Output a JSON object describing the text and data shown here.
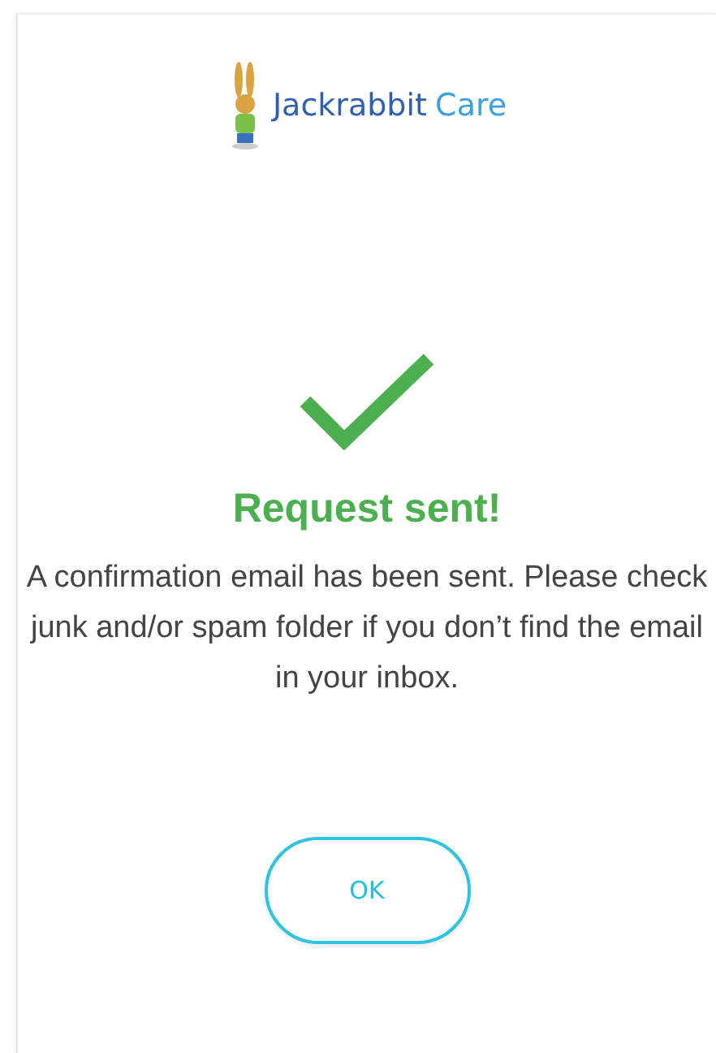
{
  "brand": {
    "name": "Jackrabbit",
    "suffix": "Care"
  },
  "status": {
    "title": "Request sent!",
    "message": "A confirmation email has been sent. Please check junk and/or spam folder if you don’t find the email in your inbox."
  },
  "buttons": [
    "OK"
  ]
}
